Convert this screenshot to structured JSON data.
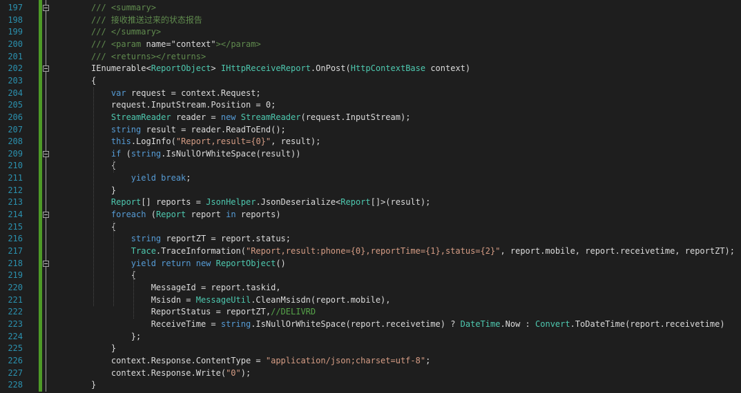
{
  "colors": {
    "background": "#1e1e1e",
    "line_number": "#2b91af",
    "keyword": "#569cd6",
    "type": "#4ec9b0",
    "comment": "#57a64a",
    "doc_comment": "#608b4e",
    "string": "#d69d85",
    "text": "#dcdcdc",
    "change_bar": "#4e9a27"
  },
  "fold_markers": [
    197,
    202,
    209,
    214,
    218
  ],
  "lines": [
    {
      "n": "197",
      "tokens": [
        [
          "/// ",
          "dc"
        ],
        [
          "<summary>",
          "dc"
        ]
      ]
    },
    {
      "n": "198",
      "tokens": [
        [
          "/// 接收推送过来的状态报告",
          "dc"
        ]
      ]
    },
    {
      "n": "199",
      "tokens": [
        [
          "/// ",
          "dc"
        ],
        [
          "</summary>",
          "dc"
        ]
      ]
    },
    {
      "n": "200",
      "tokens": [
        [
          "/// ",
          "dc"
        ],
        [
          "<param ",
          "dc"
        ],
        [
          "name=",
          "pl"
        ],
        [
          "\"context\"",
          "pl"
        ],
        [
          "></param>",
          "dc"
        ]
      ]
    },
    {
      "n": "201",
      "tokens": [
        [
          "/// ",
          "dc"
        ],
        [
          "<returns></returns>",
          "dc"
        ]
      ]
    },
    {
      "n": "202",
      "tokens": [
        [
          "IEnumerable",
          "pl"
        ],
        [
          "<",
          "pl"
        ],
        [
          "ReportObject",
          "ty"
        ],
        [
          "> ",
          "pl"
        ],
        [
          "IHttpReceiveReport",
          "ty"
        ],
        [
          ".OnPost(",
          "pl"
        ],
        [
          "HttpContextBase",
          "ty"
        ],
        [
          " context)",
          "pl"
        ]
      ]
    },
    {
      "n": "203",
      "tokens": [
        [
          "{",
          "pl"
        ]
      ]
    },
    {
      "n": "204",
      "tokens": [
        [
          "    ",
          "pl"
        ],
        [
          "var",
          "kw"
        ],
        [
          " request = context.Request;",
          "pl"
        ]
      ]
    },
    {
      "n": "205",
      "tokens": [
        [
          "    request.InputStream.Position = 0;",
          "pl"
        ]
      ]
    },
    {
      "n": "206",
      "tokens": [
        [
          "    ",
          "pl"
        ],
        [
          "StreamReader",
          "ty"
        ],
        [
          " reader = ",
          "pl"
        ],
        [
          "new",
          "kw"
        ],
        [
          " ",
          "pl"
        ],
        [
          "StreamReader",
          "ty"
        ],
        [
          "(request.InputStream);",
          "pl"
        ]
      ]
    },
    {
      "n": "207",
      "tokens": [
        [
          "    ",
          "pl"
        ],
        [
          "string",
          "kw"
        ],
        [
          " result = reader.ReadToEnd();",
          "pl"
        ]
      ]
    },
    {
      "n": "208",
      "tokens": [
        [
          "    ",
          "pl"
        ],
        [
          "this",
          "kw"
        ],
        [
          ".LogInfo(",
          "pl"
        ],
        [
          "\"Report,result={0}\"",
          "st"
        ],
        [
          ", result);",
          "pl"
        ]
      ]
    },
    {
      "n": "209",
      "tokens": [
        [
          "    ",
          "pl"
        ],
        [
          "if",
          "kw"
        ],
        [
          " (",
          "pl"
        ],
        [
          "string",
          "kw"
        ],
        [
          ".IsNullOrWhiteSpace(result))",
          "pl"
        ]
      ]
    },
    {
      "n": "210",
      "tokens": [
        [
          "    {",
          "pl"
        ]
      ]
    },
    {
      "n": "211",
      "tokens": [
        [
          "        ",
          "pl"
        ],
        [
          "yield break",
          "kw"
        ],
        [
          ";",
          "pl"
        ]
      ]
    },
    {
      "n": "212",
      "tokens": [
        [
          "    }",
          "pl"
        ]
      ]
    },
    {
      "n": "213",
      "tokens": [
        [
          "    ",
          "pl"
        ],
        [
          "Report",
          "ty"
        ],
        [
          "[] reports = ",
          "pl"
        ],
        [
          "JsonHelper",
          "ty"
        ],
        [
          ".JsonDeserialize<",
          "pl"
        ],
        [
          "Report",
          "ty"
        ],
        [
          "[]>(result);",
          "pl"
        ]
      ]
    },
    {
      "n": "214",
      "tokens": [
        [
          "    ",
          "pl"
        ],
        [
          "foreach",
          "kw"
        ],
        [
          " (",
          "pl"
        ],
        [
          "Report",
          "ty"
        ],
        [
          " report ",
          "pl"
        ],
        [
          "in",
          "kw"
        ],
        [
          " reports)",
          "pl"
        ]
      ]
    },
    {
      "n": "215",
      "tokens": [
        [
          "    {",
          "pl"
        ]
      ]
    },
    {
      "n": "216",
      "tokens": [
        [
          "        ",
          "pl"
        ],
        [
          "string",
          "kw"
        ],
        [
          " reportZT = report.status;",
          "pl"
        ]
      ]
    },
    {
      "n": "217",
      "tokens": [
        [
          "        ",
          "pl"
        ],
        [
          "Trace",
          "ty"
        ],
        [
          ".TraceInformation(",
          "pl"
        ],
        [
          "\"Report,result:phone={0},reportTime={1},status={2}\"",
          "st"
        ],
        [
          ", report.mobile, report.receivetime, reportZT);",
          "pl"
        ]
      ]
    },
    {
      "n": "218",
      "tokens": [
        [
          "        ",
          "pl"
        ],
        [
          "yield return new",
          "kw"
        ],
        [
          " ",
          "pl"
        ],
        [
          "ReportObject",
          "ty"
        ],
        [
          "()",
          "pl"
        ]
      ]
    },
    {
      "n": "219",
      "tokens": [
        [
          "        {",
          "pl"
        ]
      ]
    },
    {
      "n": "220",
      "tokens": [
        [
          "            MessageId = report.taskid,",
          "pl"
        ]
      ]
    },
    {
      "n": "221",
      "tokens": [
        [
          "            Msisdn = ",
          "pl"
        ],
        [
          "MessageUtil",
          "ty"
        ],
        [
          ".CleanMsisdn(report.mobile),",
          "pl"
        ]
      ]
    },
    {
      "n": "222",
      "tokens": [
        [
          "            ReportStatus = reportZT,",
          "pl"
        ],
        [
          "//DELIVRD",
          "cm"
        ]
      ]
    },
    {
      "n": "223",
      "tokens": [
        [
          "            ReceiveTime = ",
          "pl"
        ],
        [
          "string",
          "kw"
        ],
        [
          ".IsNullOrWhiteSpace(report.receivetime) ? ",
          "pl"
        ],
        [
          "DateTime",
          "ty"
        ],
        [
          ".Now : ",
          "pl"
        ],
        [
          "Convert",
          "ty"
        ],
        [
          ".ToDateTime(report.receivetime)",
          "pl"
        ]
      ]
    },
    {
      "n": "224",
      "tokens": [
        [
          "        };",
          "pl"
        ]
      ]
    },
    {
      "n": "225",
      "tokens": [
        [
          "    }",
          "pl"
        ]
      ]
    },
    {
      "n": "226",
      "tokens": [
        [
          "    context.Response.ContentType = ",
          "pl"
        ],
        [
          "\"application/json;charset=utf-8\"",
          "st"
        ],
        [
          ";",
          "pl"
        ]
      ]
    },
    {
      "n": "227",
      "tokens": [
        [
          "    context.Response.Write(",
          "pl"
        ],
        [
          "\"0\"",
          "st"
        ],
        [
          ");",
          "pl"
        ]
      ]
    },
    {
      "n": "228",
      "tokens": [
        [
          "}",
          "pl"
        ]
      ]
    }
  ]
}
